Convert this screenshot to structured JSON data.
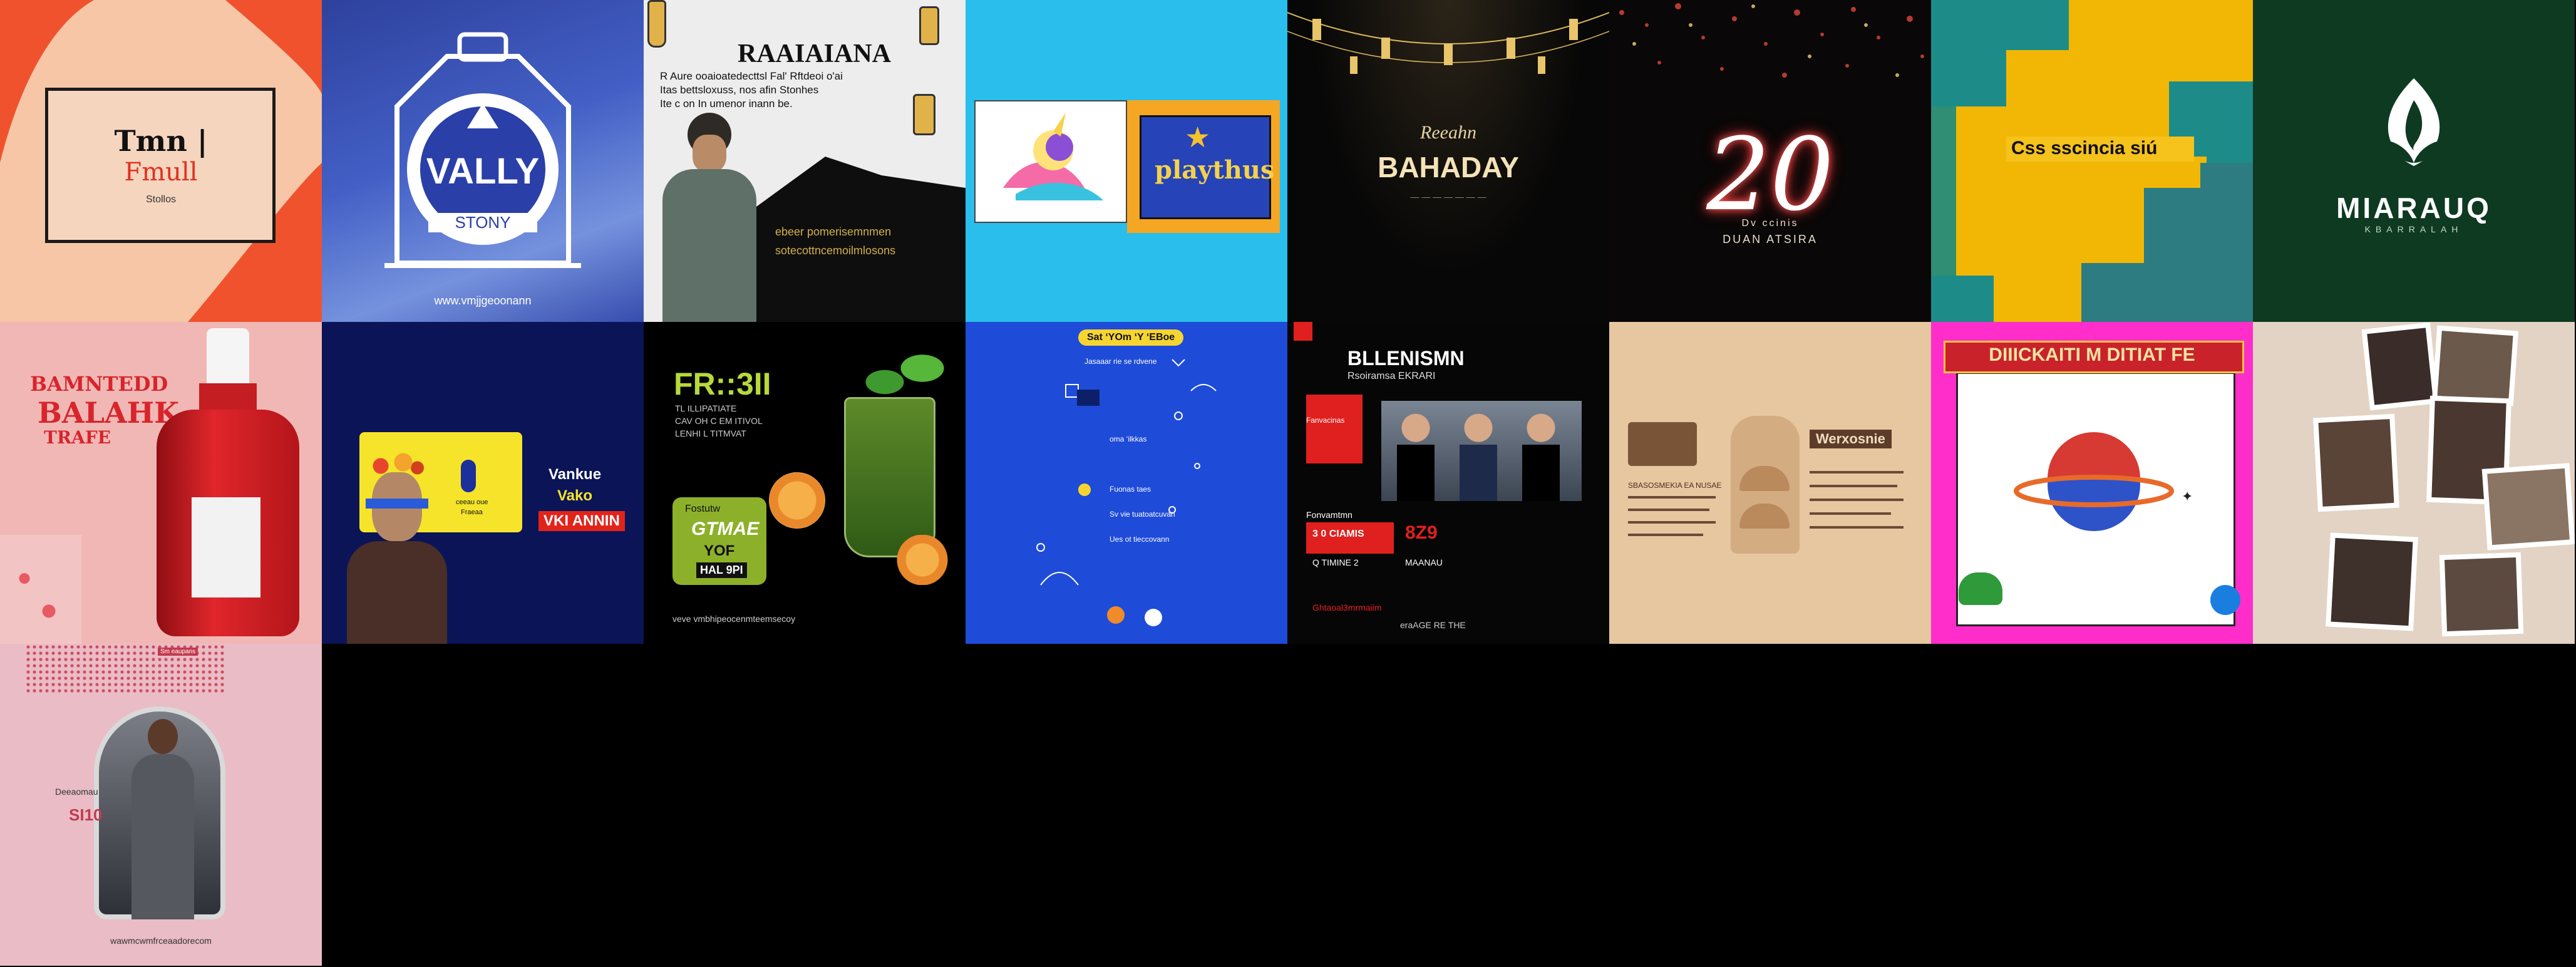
{
  "grid": {
    "tiles": [
      {
        "name": "tile-orange-frame",
        "bg": "#F6C6A6",
        "texts": {
          "line1": "Tmn |",
          "line2": "Fmull",
          "line3": "Stollos"
        }
      },
      {
        "name": "tile-blue-badge",
        "bg": "#3048A8",
        "texts": {
          "logo": "VALLY",
          "sub": "STONY",
          "url": "www.vmjjgeoonann"
        }
      },
      {
        "name": "tile-ramadan-man",
        "bg": "#EDEDED",
        "texts": {
          "title": "RAAIAIANA",
          "para1": "R Aure ooaioatedecttsl Fal' Rftdeoi o'ai",
          "para2": "Itas bettsloxuss, nos afin Stonhes",
          "para3": "Ite c on In umenor inann be.",
          "caption1": "ebeer pomerisemnmen",
          "caption2": "sotecottncemoilmlosons"
        }
      },
      {
        "name": "tile-unicorn",
        "bg": "#29BEEB",
        "texts": {
          "label": "playthus"
        }
      },
      {
        "name": "tile-ramadan-lanterns",
        "bg": "#070707",
        "texts": {
          "script": "Reeahn",
          "title": "BAHADAY",
          "sub": "— — — — — — —"
        }
      },
      {
        "name": "tile-neon-20",
        "bg": "#090707",
        "texts": {
          "number": "20",
          "line1": "Dv  ccinis",
          "line2": "DUAN  ATSIRA"
        }
      },
      {
        "name": "tile-yellow-teal",
        "bg": "#F2B705",
        "texts": {
          "banner": "Css sscincia siú"
        }
      },
      {
        "name": "tile-green-logo",
        "bg": "#0E3A22",
        "texts": {
          "name": "MIARAUQ",
          "sub": "KBARRALAH"
        }
      },
      {
        "name": "tile-red-bottle",
        "bg": "#F1B7B5",
        "texts": {
          "line1": "BAMNTEDD",
          "line2": "BALAHK",
          "line3": "TRAFE"
        }
      },
      {
        "name": "tile-flower-man",
        "bg": "#0B1457",
        "texts": {
          "card1": "ceeau oue",
          "card2": "Fraeaa",
          "line1": "Vankue",
          "line2": "Vako",
          "badge": "VKI ANNIN"
        }
      },
      {
        "name": "tile-fresh-drink",
        "bg": "#000000",
        "texts": {
          "title": "FR::3II",
          "sub1": "TL ILLIPATIATE",
          "sub2": "CAV OH C  EM ITIVOL",
          "sub3": "LENHI L TITMVAT",
          "sticker1": "Fostutw",
          "sticker2": "GTMAE",
          "sticker3": "ΥOF",
          "sticker4": "HAL 9PI",
          "url": "veve vmbhipeocenmteemsecoy"
        }
      },
      {
        "name": "tile-blue-doodles",
        "bg": "#1E4BD8",
        "texts": {
          "pill": "Sat ‘YOm ‘Y ‘EBoe",
          "row1": "Jasaaar rie se rdvene",
          "row2": "oma ‘ilkkas",
          "row3": "Fuonas taes",
          "row4": "Sv  vie tuatoatcuvan",
          "row5": "Ues ot tieccovann"
        }
      },
      {
        "name": "tile-black-news",
        "bg": "#060606",
        "texts": {
          "title": "BLLENISMN",
          "sub": "Rsoiramsa EKRARI",
          "lbl1": "Fanvacinas",
          "lbl2": "Fonvamtmn",
          "stat1": "3 0 CIAMIS",
          "stat2": "8Z9",
          "stat3": "Q  TIMINE 2",
          "stat4": "MAANAU",
          "url": "Ghtaoal3mrmaiim",
          "foot": "eraAGE   RE  THE"
        }
      },
      {
        "name": "tile-tan-menu",
        "bg": "#E6C7A0",
        "texts": {
          "head": "Werxosnie",
          "list": "SBASOSMEKIA EA NUSAE"
        }
      },
      {
        "name": "tile-pink-planet",
        "bg": "#FF2DC9",
        "texts": {
          "banner": "DIIICKAITI M DITIAT FE"
        }
      },
      {
        "name": "tile-polaroids",
        "bg": "#E3D3C4",
        "texts": {}
      },
      {
        "name": "tile-pink-fashion",
        "bg": "#E9BCC6",
        "texts": {
          "tag": "Sm eaupans",
          "line1": "Deeaomau",
          "line2": "SI10",
          "url": "wawmcwmfrceaadorecom"
        }
      }
    ]
  }
}
